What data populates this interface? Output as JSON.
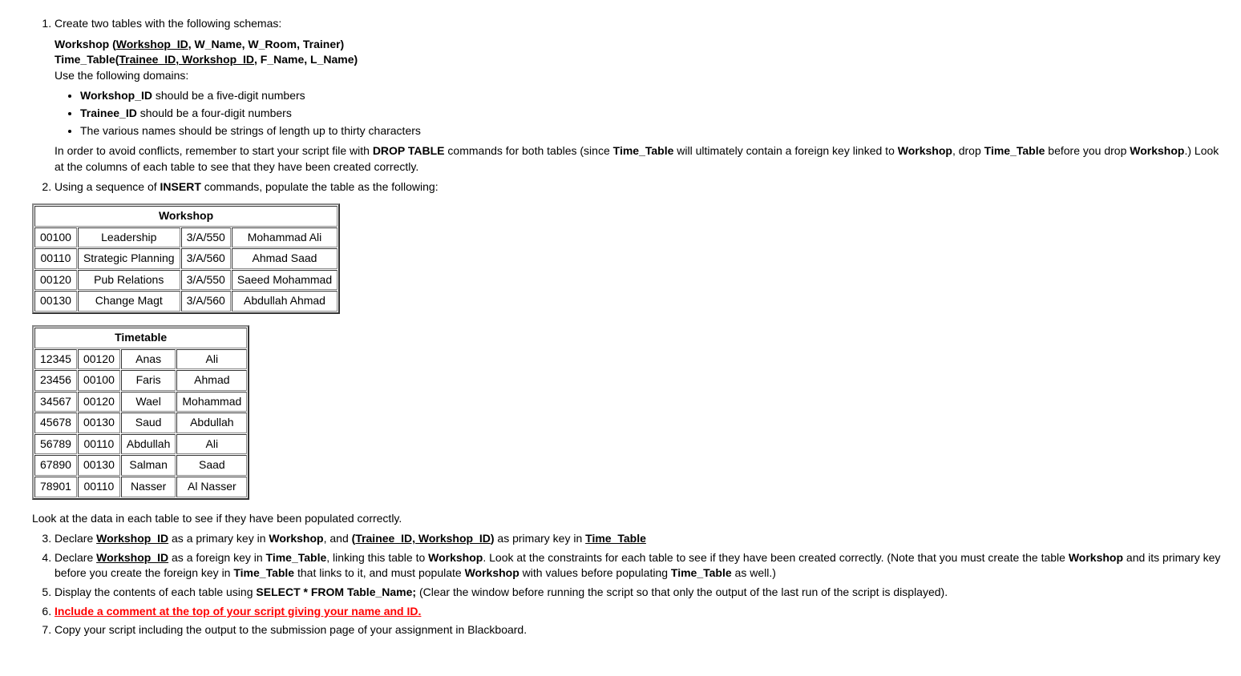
{
  "q1": {
    "intro": "Create two tables with the following schemas:",
    "schema1_pref": "Workshop (",
    "schema1_key": "Workshop_ID",
    "schema1_rest": ", W_Name, W_Room, Trainer)",
    "schema2_pref": "Time_Table(",
    "schema2_key": "Trainee_ID, Workshop_ID",
    "schema2_rest": ", F_Name, L_Name)",
    "domains_intro": "Use the following domains:",
    "bullets": {
      "b1a": "Workshop_ID",
      "b1b": " should be a  five-digit numbers",
      "b2a": "Trainee_ID",
      "b2b": " should be a four-digit numbers",
      "b3": "The various names should be strings of length up to thirty characters"
    },
    "conflict_a": "In order to avoid conflicts, remember to start your script file with ",
    "conflict_b": "DROP TABLE",
    "conflict_c": " commands for both tables (since ",
    "conflict_d": "Time_Table",
    "conflict_e": " will ultimately contain a foreign key linked to  ",
    "conflict_f": "Workshop",
    "conflict_g": ", drop ",
    "conflict_h": "Time_Table",
    "conflict_i": " before you drop  ",
    "conflict_j": "Workshop",
    "conflict_k": ".)  Look at the columns of each table to see that they have been created correctly."
  },
  "q2": {
    "a": "Using a sequence of ",
    "b": "INSERT",
    "c": " commands, populate  the table as the following:"
  },
  "workshop": {
    "title": "Workshop",
    "r1": {
      "c1": "00100",
      "c2": "Leadership",
      "c3": "3/A/550",
      "c4": "Mohammad Ali"
    },
    "r2": {
      "c1": "00110",
      "c2": "Strategic Planning",
      "c3": "3/A/560",
      "c4": "Ahmad Saad"
    },
    "r3": {
      "c1": "00120",
      "c2": "Pub Relations",
      "c3": "3/A/550",
      "c4": "Saeed Mohammad"
    },
    "r4": {
      "c1": "00130",
      "c2": "Change Magt",
      "c3": "3/A/560",
      "c4": "Abdullah Ahmad"
    }
  },
  "timetable": {
    "title": "Timetable",
    "r1": {
      "c1": "12345",
      "c2": "00120",
      "c3": "Anas",
      "c4": "Ali"
    },
    "r2": {
      "c1": "23456",
      "c2": "00100",
      "c3": "Faris",
      "c4": "Ahmad"
    },
    "r3": {
      "c1": "34567",
      "c2": "00120",
      "c3": "Wael",
      "c4": "Mohammad"
    },
    "r4": {
      "c1": "45678",
      "c2": "00130",
      "c3": "Saud",
      "c4": "Abdullah"
    },
    "r5": {
      "c1": "56789",
      "c2": "00110",
      "c3": "Abdullah",
      "c4": "Ali"
    },
    "r6": {
      "c1": "67890",
      "c2": "00130",
      "c3": "Salman",
      "c4": "Saad"
    },
    "r7": {
      "c1": "78901",
      "c2": "00110",
      "c3": "Nasser",
      "c4": "Al Nasser"
    }
  },
  "after_tables": "Look at the data in each table to see if they have been populated correctly.",
  "q3": {
    "a": "Declare ",
    "b": "Workshop_ID",
    "c": " as a primary key in ",
    "d": "Workshop",
    "e": ", and ",
    "f": "(",
    "g": "Trainee_ID, Workshop_ID",
    "h": ")",
    "i": " as primary key in ",
    "j": "Time_Table"
  },
  "q4": {
    "a": "Declare ",
    "b": "Workshop_ID",
    "c": " as a foreign key in ",
    "d": "Time_Table",
    "e": ", linking this table to ",
    "f": "Workshop",
    "g": ".   Look at the constraints for each table to see if they have been created correctly. (Note that you must create the table ",
    "h": "Workshop",
    "i": " and its primary key before you create the foreign key in ",
    "j": "Time_Table",
    "k": " that links to it, and must populate ",
    "l": "Workshop",
    "m": " with values before populating ",
    "n": "Time_Table",
    "o": " as well.)"
  },
  "q5": {
    "a": "Display the contents of each table using ",
    "b": "SELECT * FROM Table_Name;",
    "c": " (Clear the window before running the script so that only the output of the last run of the script is displayed)."
  },
  "q6": "Include a comment at the top of your script giving your name and ID.",
  "q7": "Copy your script including the output to the submission page of your assignment in Blackboard."
}
